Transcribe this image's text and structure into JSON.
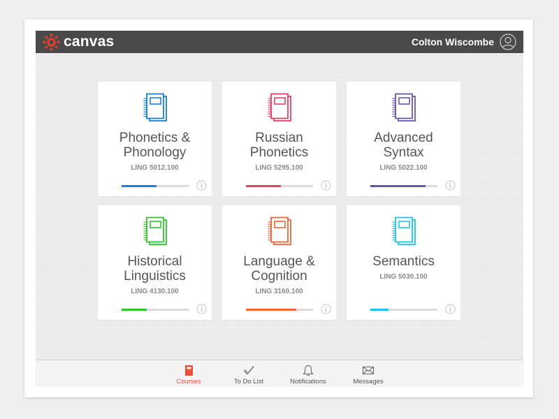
{
  "app": {
    "name": "canvas",
    "brand_color": "#e03f2d"
  },
  "user": {
    "name": "Colton Wiscombe"
  },
  "courses": [
    {
      "title_lines": [
        "Phonetics &",
        "Phonology"
      ],
      "code": "LING 5012.100",
      "color": "#1a7fdc",
      "progress": 0.52
    },
    {
      "title_lines": [
        "Russian",
        "Phonetics"
      ],
      "code": "LING 5295.100",
      "color": "#e83e64",
      "progress": 0.52
    },
    {
      "title_lines": [
        "Advanced",
        "Syntax"
      ],
      "code": "LING 5022.100",
      "color": "#6656b3",
      "progress": 0.82
    },
    {
      "title_lines": [
        "Historical",
        "Linguistics"
      ],
      "code": "LING 4130.100",
      "color": "#2ec52e",
      "progress": 0.38
    },
    {
      "title_lines": [
        "Language &",
        "Cognition"
      ],
      "code": "LING 3160.100",
      "color": "#ef6438",
      "progress": 0.75
    },
    {
      "title_lines": [
        "Semantics"
      ],
      "code": "LING 5030.100",
      "color": "#1fc5e8",
      "progress": 0.27
    }
  ],
  "nav": {
    "tabs": [
      {
        "label": "Courses",
        "icon": "courses-icon",
        "active": true
      },
      {
        "label": "To Do List",
        "icon": "checkmark-icon",
        "active": false
      },
      {
        "label": "Notifications",
        "icon": "bell-icon",
        "active": false
      },
      {
        "label": "Messages",
        "icon": "envelope-icon",
        "active": false
      }
    ],
    "active_color": "#e8503a"
  }
}
